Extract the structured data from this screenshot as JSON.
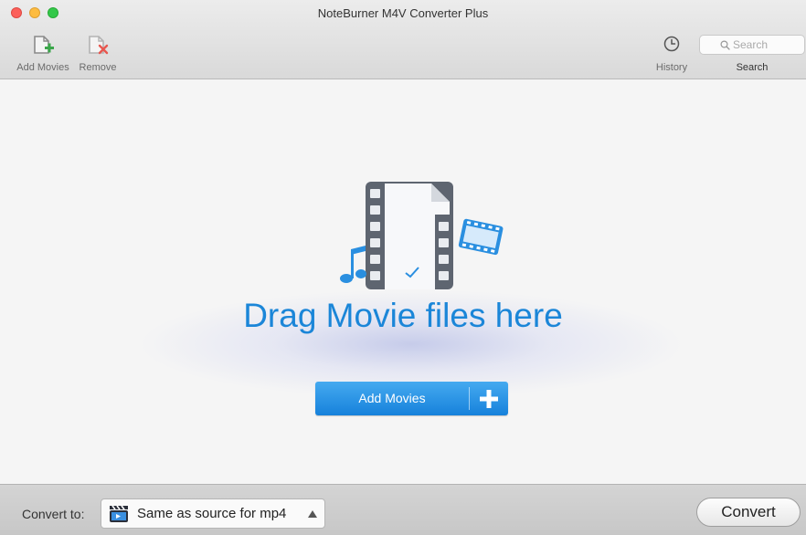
{
  "window": {
    "title": "NoteBurner M4V Converter Plus"
  },
  "toolbar": {
    "add_movies_label": "Add Movies",
    "remove_label": "Remove",
    "history_label": "History",
    "search_placeholder": "Search",
    "search_value": "",
    "search_label": "Search"
  },
  "drop_zone": {
    "prompt": "Drag Movie files here",
    "add_button_label": "Add Movies"
  },
  "bottom_bar": {
    "convert_to_label": "Convert to:",
    "format_value": "Same as source for mp4",
    "convert_button_label": "Convert"
  },
  "icons": {
    "add": "file-plus-icon",
    "remove": "file-remove-icon",
    "history": "clock-icon",
    "search": "magnifier-icon",
    "format": "clapperboard-icon",
    "dropdown": "caret-up-icon"
  },
  "colors": {
    "accent_blue": "#1b86d8",
    "button_blue": "#2a93e4",
    "add_green": "#3aa64a",
    "remove_red": "#e8574f"
  }
}
